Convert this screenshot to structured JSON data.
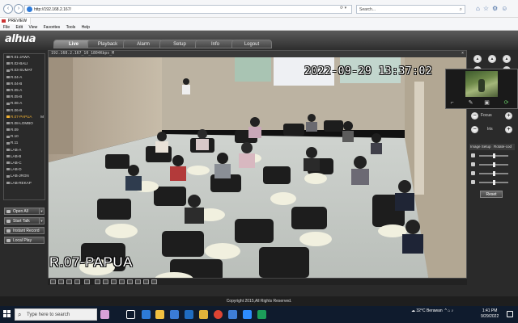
{
  "browser": {
    "url": "http://192.168.2.167/",
    "search_placeholder": "Search...",
    "tab_title": "PREVIEW",
    "menu": [
      "File",
      "Edit",
      "View",
      "Favorites",
      "Tools",
      "Help"
    ]
  },
  "app": {
    "logo": "alhua",
    "tabs": [
      "Live",
      "Playback",
      "Alarm",
      "Setup",
      "Info",
      "Logout"
    ],
    "active_tab": "Live",
    "copyright": "Copyright 2015,All Rights Reserved."
  },
  "channels": [
    "R.01-JAWA",
    "R.02-BALI",
    "R.03-SUMAT",
    "R.04-A",
    "R.04-B",
    "R.05-A",
    "R.05-B",
    "R.06-A",
    "R.06-B",
    "R.07-PAPUA",
    "R.08-LOMBO",
    "R.09",
    "R.10",
    "R.11",
    "LAB-A",
    "LAB-B",
    "LAB-C",
    "LAB-D",
    "LAB-JRGN",
    "LAB-REKAP"
  ],
  "active_channel": "R.07-PAPUA",
  "active_channel_marker": "M",
  "side_buttons": {
    "open_all": "Open All",
    "start_talk": "Start Talk",
    "instant_record": "Instant Record",
    "local_play": "Local Play"
  },
  "video": {
    "stream_label": "192.168.2.167_10_1804Kbps_M",
    "osd_timestamp": "2022-09-29 13:37:02",
    "osd_name": "R.07-PAPUA"
  },
  "ptz": {
    "focus_label": "Focus",
    "iris_label": "Iris",
    "image_setup_label": "Image Setup",
    "rotate_label": "Rotate-cod",
    "reset_label": "Reset"
  },
  "taskbar": {
    "search_placeholder": "Type here to search",
    "weather": "32°C  Berawan",
    "time": "1:41 PM",
    "date": "9/29/2022"
  }
}
